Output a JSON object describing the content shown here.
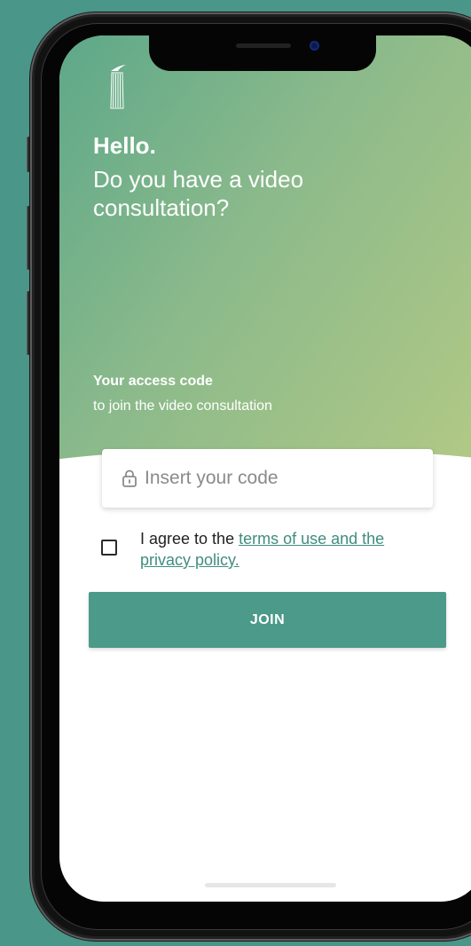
{
  "hero": {
    "greeting": "Hello.",
    "question": "Do you have a video consultation?"
  },
  "access_code": {
    "title": "Your access code",
    "subtitle": "to join the video consultation",
    "placeholder": "Insert your code",
    "icon": "lock-icon"
  },
  "consent": {
    "checked": false,
    "prefix": "I agree to the ",
    "link_text": "terms of use and the privacy policy."
  },
  "actions": {
    "join_label": "JOIN"
  },
  "colors": {
    "background": "#4a9689",
    "gradient_start": "#5da889",
    "gradient_end": "#b2c985",
    "accent": "#4b9a8a",
    "link": "#3f8d7f"
  }
}
